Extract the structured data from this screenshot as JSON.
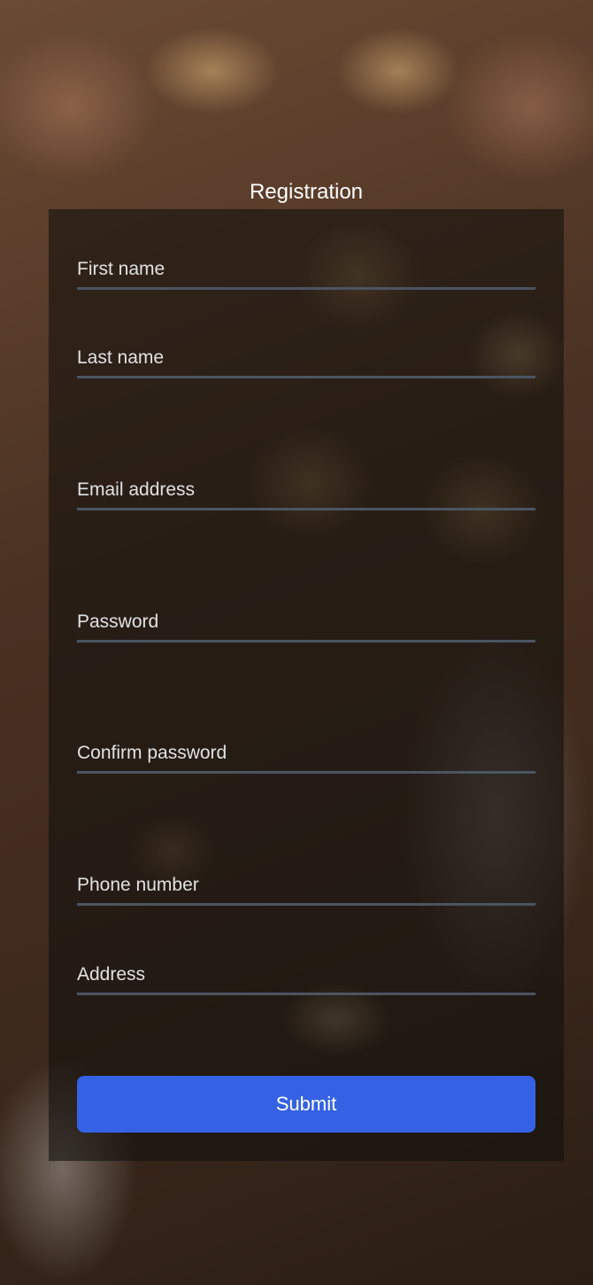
{
  "form": {
    "title": "Registration",
    "fields": [
      {
        "placeholder": "First name",
        "value": ""
      },
      {
        "placeholder": "Last name",
        "value": ""
      },
      {
        "placeholder": "Email address",
        "value": ""
      },
      {
        "placeholder": "Password",
        "value": ""
      },
      {
        "placeholder": "Confirm password",
        "value": ""
      },
      {
        "placeholder": "Phone number",
        "value": ""
      },
      {
        "placeholder": "Address",
        "value": ""
      }
    ],
    "submit_label": "Submit"
  }
}
